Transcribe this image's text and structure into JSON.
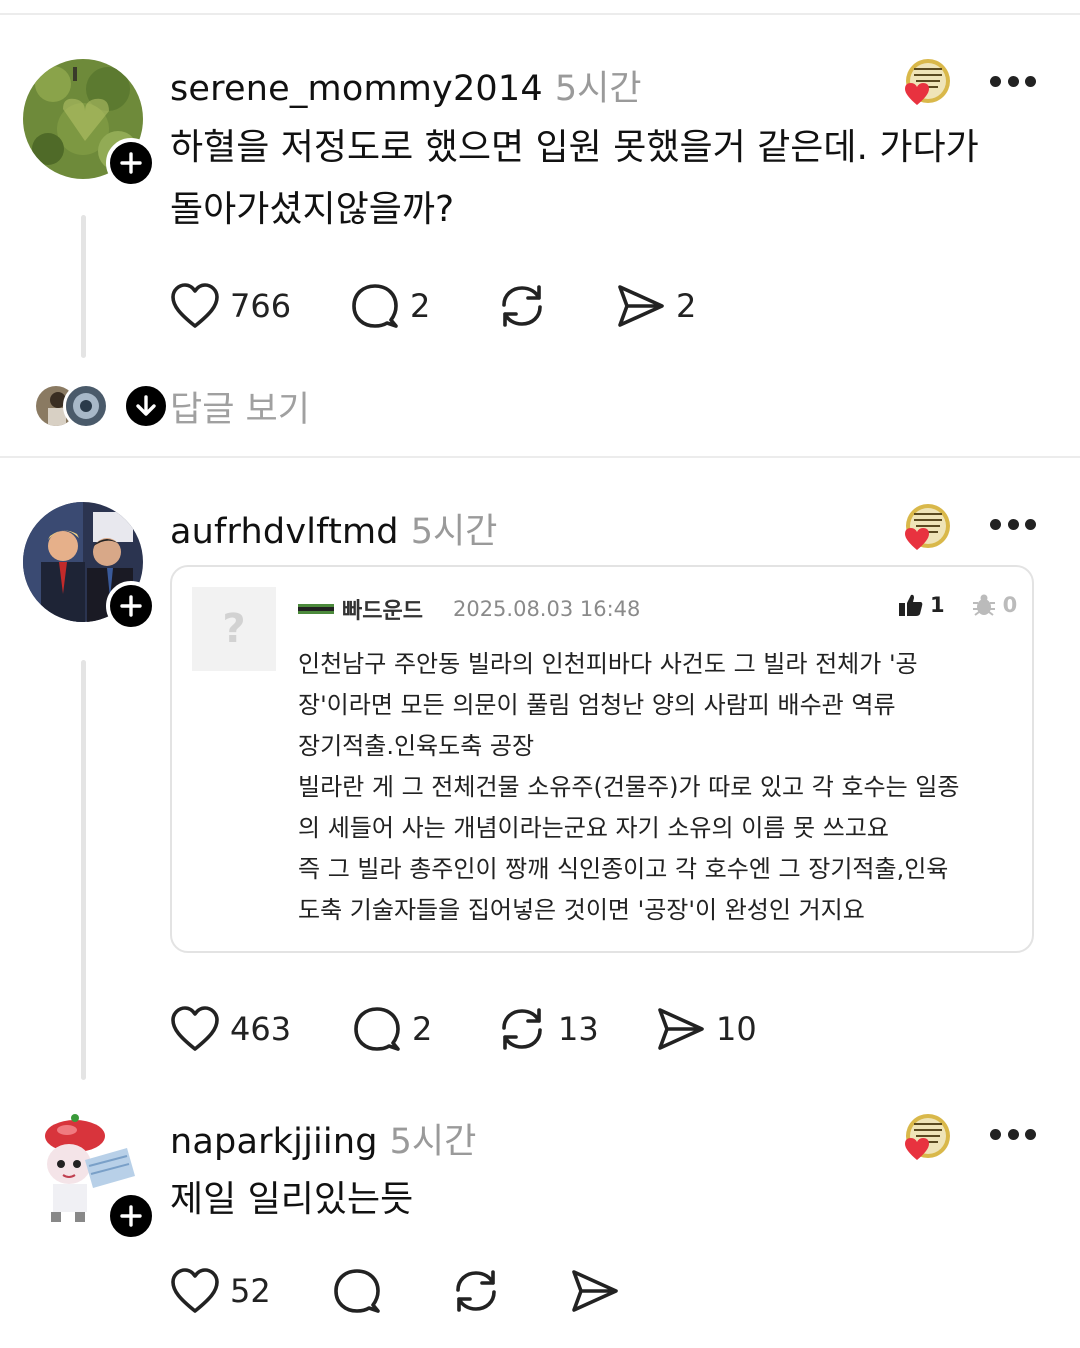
{
  "posts": [
    {
      "username": "serene_mommy2014",
      "time": "5시간",
      "text_lines": [
        "하혈을 저정도로 했으면 입원 못했을거 같은데. 가다가",
        "돌아가셨지않을까?"
      ],
      "likes": "766",
      "comments": "2",
      "reposts": "",
      "shares": "2",
      "see_replies": "답글 보기"
    },
    {
      "username": "aufrhdvlftmd",
      "time": "5시간",
      "quote": {
        "thumb": "?",
        "author": "빠드운드",
        "date": "2025.08.03 16:48",
        "upvotes": "1",
        "downvotes": "0",
        "lines": [
          "인천남구 주안동 빌라의 인천피바다 사건도 그 빌라 전체가 '공",
          "장'이라면 모든 의문이 풀림 엄청난 양의 사람피 배수관 역류",
          "장기적출.인육도축 공장",
          "빌라란 게 그 전체건물 소유주(건물주)가 따로 있고 각 호수는 일종",
          "의 세들어 사는 개념이라는군요 자기 소유의 이름 못 쓰고요",
          "즉 그 빌라 총주인이 짱깨 식인종이고 각 호수엔 그 장기적출,인육",
          "도축 기술자들을 집어넣은 것이면 '공장'이 완성인 거지요"
        ]
      },
      "likes": "463",
      "comments": "2",
      "reposts": "13",
      "shares": "10"
    },
    {
      "username": "naparkjjiing",
      "time": "5시간",
      "text_lines": [
        "제일 일리있는듯"
      ],
      "likes": "52",
      "comments": "",
      "reposts": "",
      "shares": ""
    }
  ],
  "icons": {
    "like": "heart-icon",
    "comment": "speech-bubble-icon",
    "repost": "repost-icon",
    "share": "send-icon",
    "more": "more-dots-icon",
    "follow": "plus-icon",
    "award": "award-badge-icon"
  },
  "colors": {
    "heart_badge": "#e8323f",
    "muted_text": "#9a9a9a",
    "divider": "#ececec"
  }
}
